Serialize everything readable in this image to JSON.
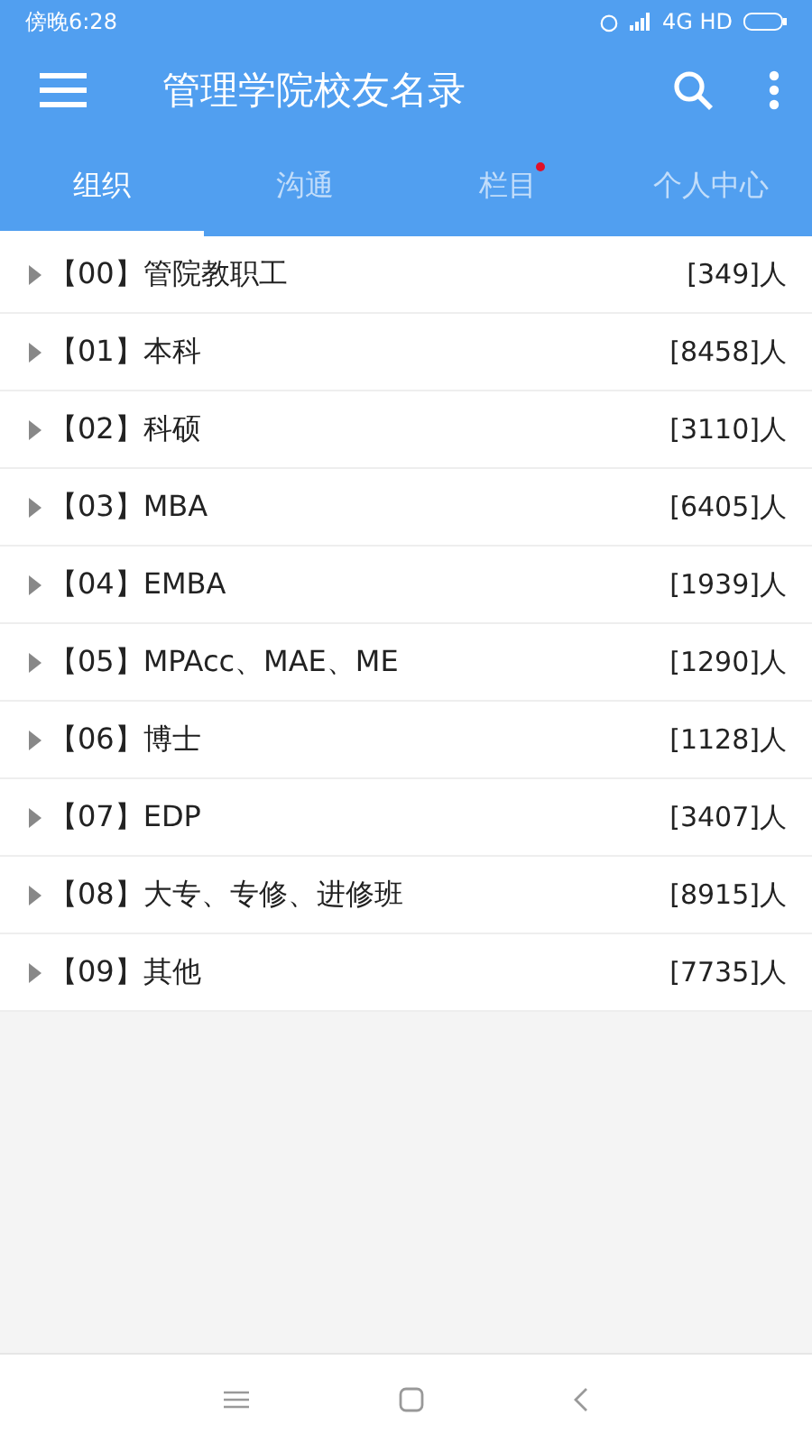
{
  "status_bar": {
    "time": "傍晚6:28",
    "network": "4G HD"
  },
  "app_bar": {
    "title": "管理学院校友名录"
  },
  "tabs": [
    {
      "label": "组织",
      "selected": true,
      "badge": false
    },
    {
      "label": "沟通",
      "selected": false,
      "badge": false
    },
    {
      "label": "栏目",
      "selected": false,
      "badge": true
    },
    {
      "label": "个人中心",
      "selected": false,
      "badge": false
    }
  ],
  "groups": [
    {
      "label": "【00】管院教职工",
      "count": "[349]人"
    },
    {
      "label": "【01】本科",
      "count": "[8458]人"
    },
    {
      "label": "【02】科硕",
      "count": "[3110]人"
    },
    {
      "label": "【03】MBA",
      "count": "[6405]人"
    },
    {
      "label": "【04】EMBA",
      "count": "[1939]人"
    },
    {
      "label": "【05】MPAcc、MAE、ME",
      "count": "[1290]人"
    },
    {
      "label": "【06】博士",
      "count": "[1128]人"
    },
    {
      "label": "【07】EDP",
      "count": "[3407]人"
    },
    {
      "label": "【08】大专、专修、进修班",
      "count": "[8915]人"
    },
    {
      "label": "【09】其他",
      "count": "[7735]人"
    }
  ]
}
